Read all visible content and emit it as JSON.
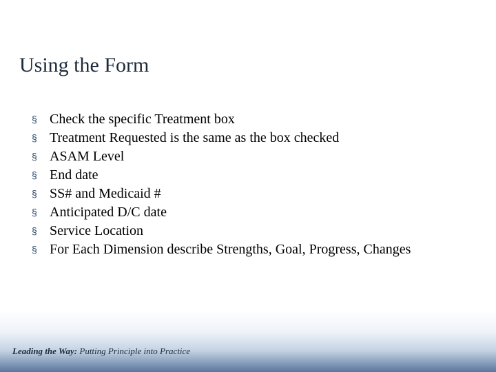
{
  "title": "Using the Form",
  "bullets": [
    "Check the specific Treatment box",
    "Treatment Requested is the same as the box checked",
    "ASAM Level",
    "End date",
    "SS# and Medicaid #",
    "Anticipated D/C date",
    "Service Location",
    "For Each Dimension describe Strengths, Goal, Progress, Changes"
  ],
  "bullet_marker": "§",
  "footer": {
    "lead": "Leading the Way:",
    "sub": " Putting Principle into Practice"
  }
}
